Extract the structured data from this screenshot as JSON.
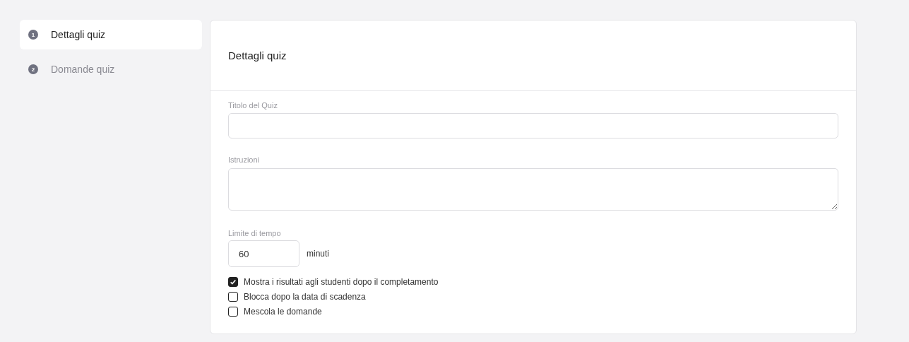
{
  "steps": [
    {
      "number": "1",
      "label": "Dettagli quiz",
      "selected": true
    },
    {
      "number": "2",
      "label": "Domande quiz",
      "selected": false
    }
  ],
  "card": {
    "title": "Dettagli quiz",
    "title_field": {
      "label": "Titolo del Quiz"
    },
    "instructions_field": {
      "label": "Istruzioni"
    },
    "time_limit": {
      "label": "Limite di tempo",
      "value": "60",
      "unit": "minuti"
    },
    "options": [
      {
        "label": "Mostra i risultati agli studenti dopo il completamento",
        "checked": true
      },
      {
        "label": "Blocca dopo la data di scadenza",
        "checked": false
      },
      {
        "label": "Mescola le domande",
        "checked": false
      }
    ]
  }
}
